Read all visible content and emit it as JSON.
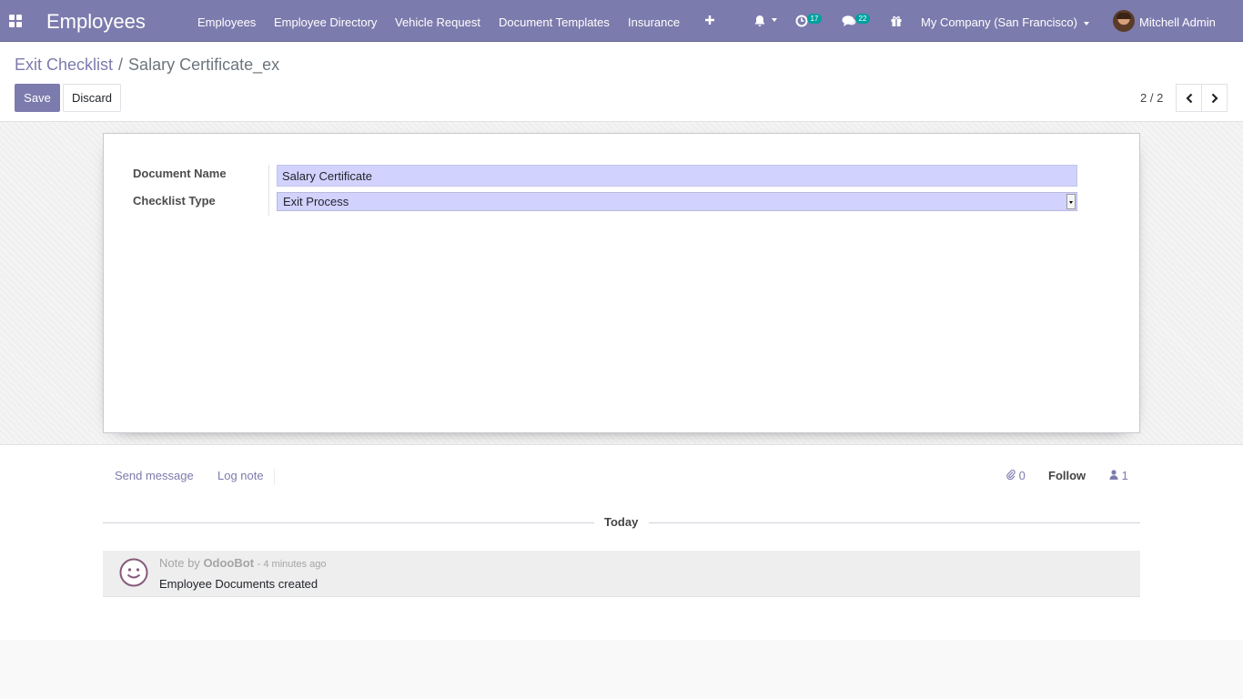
{
  "navbar": {
    "app_name": "Employees",
    "menu": [
      "Employees",
      "Employee Directory",
      "Vehicle Request",
      "Document Templates",
      "Insurance"
    ],
    "activity_count": "17",
    "message_count": "22",
    "company": "My Company (San Francisco)",
    "user": "Mitchell Admin",
    "icons": [
      "apps-icon",
      "plus-icon",
      "bell-icon",
      "clock-icon",
      "chat-icon",
      "gift-icon"
    ]
  },
  "breadcrumb": {
    "parent": "Exit Checklist",
    "separator": "/",
    "current": "Salary Certificate_ex"
  },
  "buttons": {
    "save": "Save",
    "discard": "Discard"
  },
  "pager": {
    "value": "2 / 2"
  },
  "form": {
    "document_name_label": "Document Name",
    "document_name_value": "Salary Certificate",
    "checklist_type_label": "Checklist Type",
    "checklist_type_value": "Exit Process"
  },
  "chatter": {
    "send_message": "Send message",
    "log_note": "Log note",
    "attachments_count": "0",
    "follow": "Follow",
    "followers_count": "1",
    "day_label": "Today",
    "message": {
      "prefix": "Note by",
      "author": "OdooBot",
      "time": "- 4 minutes ago",
      "body": "Employee Documents created"
    }
  },
  "colors": {
    "primary": "#7c7bad",
    "field_bg": "#d2d2ff",
    "badge": "#00a09d"
  }
}
